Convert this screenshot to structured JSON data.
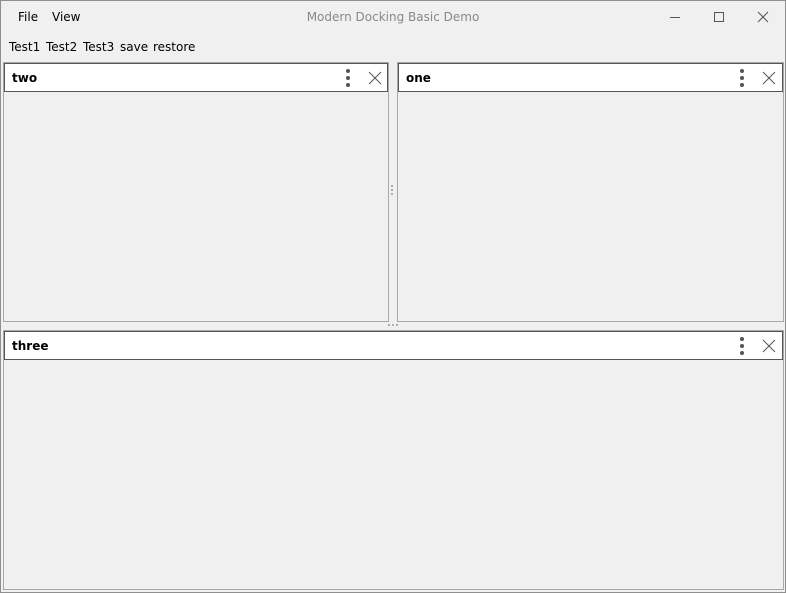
{
  "window": {
    "title": "Modern Docking Basic Demo",
    "menu": [
      "File",
      "View"
    ]
  },
  "toolbar": [
    "Test1",
    "Test2",
    "Test3",
    "save",
    "restore"
  ],
  "panels": {
    "two": {
      "title": "two"
    },
    "one": {
      "title": "one"
    },
    "three": {
      "title": "three"
    }
  },
  "icons": {
    "minimize": "minimize-icon",
    "maximize": "maximize-icon",
    "close": "close-icon",
    "panel_menu": "more-vertical-icon",
    "panel_close": "close-icon"
  }
}
